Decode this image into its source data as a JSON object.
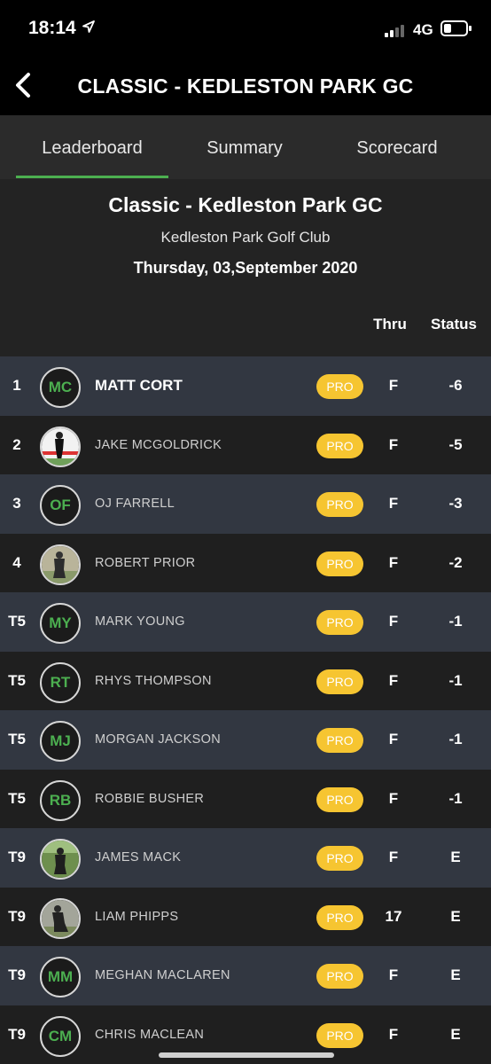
{
  "status_bar": {
    "time": "18:14",
    "network": "4G"
  },
  "nav": {
    "title": "CLASSIC - KEDLESTON PARK GC"
  },
  "tabs": [
    {
      "label": "Leaderboard"
    },
    {
      "label": "Summary"
    },
    {
      "label": "Scorecard"
    }
  ],
  "event": {
    "title": "Classic - Kedleston Park GC",
    "club": "Kedleston Park Golf Club",
    "date": "Thursday, 03,September 2020"
  },
  "columns": {
    "thru": "Thru",
    "status": "Status"
  },
  "players": [
    {
      "pos": "1",
      "initials": "MC",
      "name": "MATT CORT",
      "badge": "PRO",
      "thru": "F",
      "status": "-6"
    },
    {
      "pos": "2",
      "initials": "",
      "name": "JAKE MCGOLDRICK",
      "badge": "PRO",
      "thru": "F",
      "status": "-5"
    },
    {
      "pos": "3",
      "initials": "OF",
      "name": "OJ FARRELL",
      "badge": "PRO",
      "thru": "F",
      "status": "-3"
    },
    {
      "pos": "4",
      "initials": "",
      "name": "ROBERT PRIOR",
      "badge": "PRO",
      "thru": "F",
      "status": "-2"
    },
    {
      "pos": "T5",
      "initials": "MY",
      "name": "MARK YOUNG",
      "badge": "PRO",
      "thru": "F",
      "status": "-1"
    },
    {
      "pos": "T5",
      "initials": "RT",
      "name": "RHYS THOMPSON",
      "badge": "PRO",
      "thru": "F",
      "status": "-1"
    },
    {
      "pos": "T5",
      "initials": "MJ",
      "name": "MORGAN JACKSON",
      "badge": "PRO",
      "thru": "F",
      "status": "-1"
    },
    {
      "pos": "T5",
      "initials": "RB",
      "name": "ROBBIE BUSHER",
      "badge": "PRO",
      "thru": "F",
      "status": "-1"
    },
    {
      "pos": "T9",
      "initials": "",
      "name": "JAMES MACK",
      "badge": "PRO",
      "thru": "F",
      "status": "E"
    },
    {
      "pos": "T9",
      "initials": "",
      "name": "LIAM PHIPPS",
      "badge": "PRO",
      "thru": "17",
      "status": "E"
    },
    {
      "pos": "T9",
      "initials": "MM",
      "name": "MEGHAN MACLAREN",
      "badge": "PRO",
      "thru": "F",
      "status": "E"
    },
    {
      "pos": "T9",
      "initials": "CM",
      "name": "CHRIS MACLEAN",
      "badge": "PRO",
      "thru": "F",
      "status": "E"
    }
  ],
  "colors": {
    "accent_green": "#4caf50",
    "badge_yellow": "#f6c531",
    "row_odd": "#323741",
    "row_even": "#1f1f1f",
    "background": "#232323"
  },
  "icons": [
    "location-arrow-icon",
    "signal-icon",
    "battery-icon",
    "back-chevron-icon"
  ]
}
